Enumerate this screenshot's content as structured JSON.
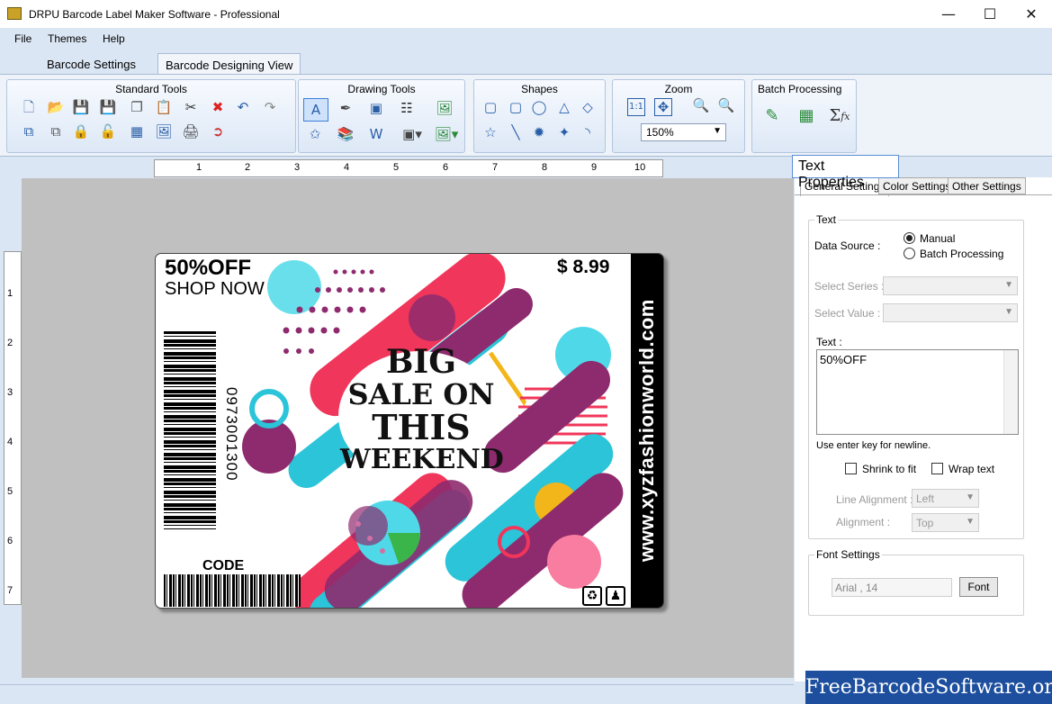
{
  "window": {
    "title": "DRPU Barcode Label Maker Software - Professional"
  },
  "menu": [
    "File",
    "Themes",
    "Help"
  ],
  "tabs": [
    {
      "label": "Barcode Settings"
    },
    {
      "label": "Barcode Designing View"
    }
  ],
  "ribbon": {
    "groups": [
      {
        "title": "Standard Tools"
      },
      {
        "title": "Drawing Tools"
      },
      {
        "title": "Shapes"
      },
      {
        "title": "Zoom",
        "zoom_value": "150%"
      },
      {
        "title": "Batch Processing"
      }
    ]
  },
  "rulers": {
    "horizontal": [
      "1",
      "2",
      "3",
      "4",
      "5",
      "6",
      "7",
      "8",
      "9",
      "10"
    ],
    "vertical": [
      "1",
      "2",
      "3",
      "4",
      "5",
      "6",
      "7"
    ]
  },
  "label_design": {
    "headline": "50%OFF",
    "subline": "SHOP NOW",
    "price": "$ 8.99",
    "big_text": [
      "BIG",
      "SALE ON",
      "THIS",
      "WEEKEND"
    ],
    "barcode_number": "0973001300",
    "code_label": "CODE",
    "website": "www.xyzfashionworld.com",
    "colors": {
      "accent_red": "#f0365a",
      "accent_cyan": "#2bc4d8",
      "accent_purple": "#8e2a6e",
      "accent_yellow": "#f2b61a",
      "accent_green": "#3ab54a"
    }
  },
  "properties": {
    "title": "Text Properties",
    "tabs": [
      "General Settings",
      "Color Settings",
      "Other Settings"
    ],
    "text_section": {
      "legend": "Text",
      "data_source_label": "Data Source :",
      "options": [
        "Manual",
        "Batch Processing"
      ],
      "selected": "Manual",
      "select_series_label": "Select Series :",
      "select_value_label": "Select Value :",
      "text_label": "Text :",
      "text_value": "50%OFF",
      "hint": "Use enter key for newline.",
      "shrink_to_fit": "Shrink to fit",
      "wrap_text": "Wrap text",
      "line_alignment_label": "Line Alignment :",
      "line_alignment_value": "Left",
      "alignment_label": "Alignment :",
      "alignment_value": "Top"
    },
    "font_section": {
      "legend": "Font Settings",
      "font_value": "Arial , 14",
      "font_button": "Font"
    }
  },
  "watermark": "FreeBarcodeSoftware.org"
}
